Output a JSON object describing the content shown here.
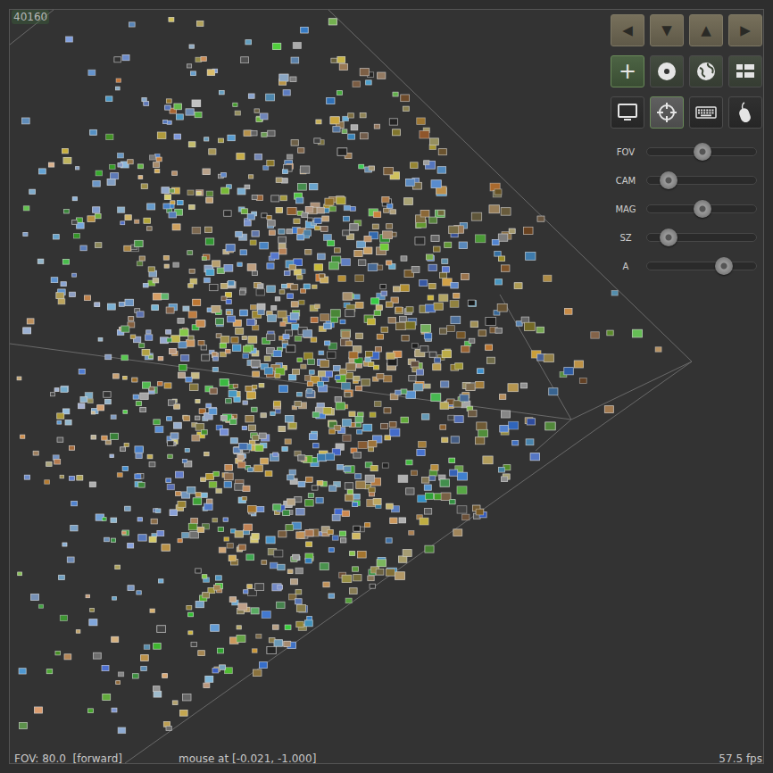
{
  "counter": "40160",
  "nav_buttons": [
    {
      "label": "◀"
    },
    {
      "label": "▼"
    },
    {
      "label": "▲"
    },
    {
      "label": "▶"
    }
  ],
  "mode_buttons": [
    {
      "label": "+",
      "selected": true
    },
    {
      "label": "",
      "selected": false
    },
    {
      "label": "",
      "selected": false
    },
    {
      "label": "",
      "selected": false
    }
  ],
  "view_buttons": [
    {
      "selected": false
    },
    {
      "selected": true
    },
    {
      "selected": false
    },
    {
      "selected": false
    }
  ],
  "sliders": [
    {
      "label": "FOV",
      "level": 0.5
    },
    {
      "label": "CAM",
      "level": 0.13
    },
    {
      "label": "MAG",
      "level": 0.5
    },
    {
      "label": "SZ",
      "level": 0.13
    },
    {
      "label": "A",
      "level": 0.73
    }
  ],
  "status_bar": {
    "view": "FOV: 80.0  [forward]",
    "mouse": "mouse at [-0.021, -1.000]",
    "fps": "57.5 fps"
  }
}
